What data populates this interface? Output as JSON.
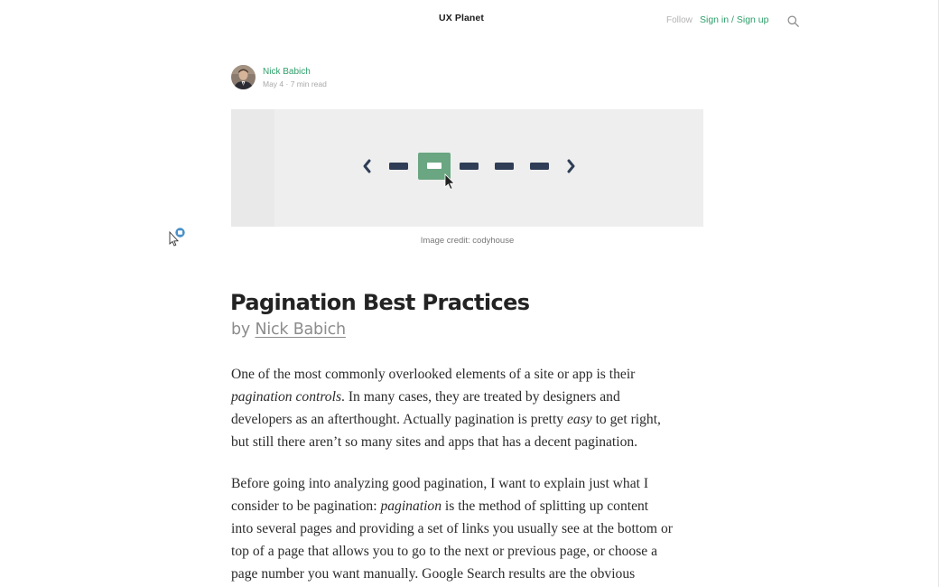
{
  "header": {
    "brand": "UX Planet",
    "follow_label": "Follow",
    "signin_label": "Sign in / Sign up",
    "search_icon": "search-icon"
  },
  "author": {
    "name": "Nick Babich",
    "meta": "May 4 · 7 min read"
  },
  "hero": {
    "caption": "Image credit: codyhouse",
    "accent_color": "#6aa681",
    "dash_color": "#2f3e56"
  },
  "article": {
    "title": "Pagination Best Practices",
    "by_prefix": "by",
    "by_author": "Nick Babich",
    "p1": {
      "l1": "One of the most commonly overlooked elements of a site or app is their",
      "l2_em": "pagination controls",
      "l2_rest": ". In many cases, they are treated by designers and",
      "l3_a": "developers as an afterthought. Actually pagination is pretty ",
      "l3_em": "easy",
      "l3_b": " to get right,",
      "l4": "but still there aren’t so many sites and apps that has a decent pagination."
    },
    "p2": {
      "l1": "Before going into analyzing good pagination, I want to explain just what I",
      "l2_a": "consider to be pagination: ",
      "l2_em": "pagination",
      "l2_b": " is the method of splitting up content",
      "l3": "into several pages and providing a set of links you usually see at the bottom or",
      "l4": "top of a page that allows you to go to the next or previous page, or choose a",
      "l5": "page number you want manually. Google Search results are the obvious"
    }
  }
}
